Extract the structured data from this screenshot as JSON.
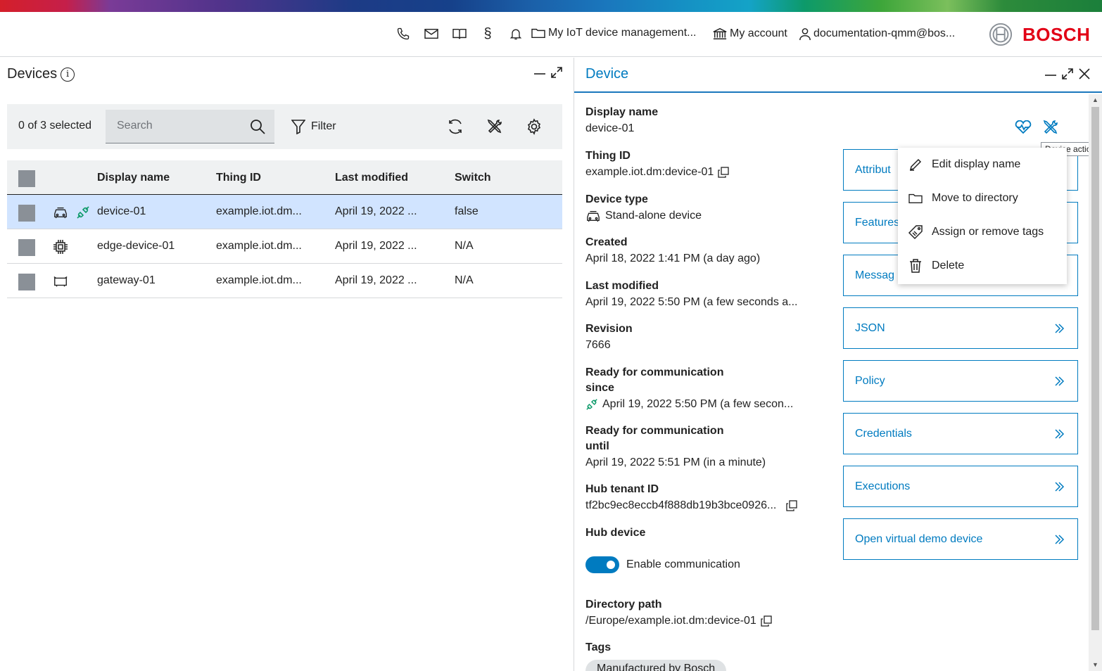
{
  "header": {
    "links": {
      "directory": "My IoT device management...",
      "account": "My account",
      "user": "documentation-qmm@bos..."
    },
    "brand": "BOSCH"
  },
  "devices_panel": {
    "title": "Devices",
    "selected_count": "0 of 3 selected",
    "search_placeholder": "Search",
    "filter_label": "Filter",
    "columns": [
      "Display name",
      "Thing ID",
      "Last modified",
      "Switch"
    ],
    "rows": [
      {
        "display_name": "device-01",
        "thing_id": "example.iot.dm...",
        "last_modified": "April 19, 2022 ...",
        "switch": "false",
        "type_icon": "car-icon",
        "connected": true
      },
      {
        "display_name": "edge-device-01",
        "thing_id": "example.iot.dm...",
        "last_modified": "April 19, 2022 ...",
        "switch": "N/A",
        "type_icon": "chip-icon",
        "connected": false
      },
      {
        "display_name": "gateway-01",
        "thing_id": "example.iot.dm...",
        "last_modified": "April 19, 2022 ...",
        "switch": "N/A",
        "type_icon": "gateway-icon",
        "connected": false
      }
    ]
  },
  "device_panel": {
    "title": "Device",
    "fields": {
      "display_name": {
        "label": "Display name",
        "value": "device-01"
      },
      "thing_id": {
        "label": "Thing ID",
        "value": "example.iot.dm:device-01"
      },
      "device_type": {
        "label": "Device type",
        "value": "Stand-alone device"
      },
      "created": {
        "label": "Created",
        "value": "April 18, 2022 1:41 PM (a day ago)"
      },
      "last_modified": {
        "label": "Last modified",
        "value": "April 19, 2022 5:50 PM (a few seconds a..."
      },
      "revision": {
        "label": "Revision",
        "value": "7666"
      },
      "ready_since": {
        "label_1": "Ready for communication",
        "label_2": "since",
        "value": "April 19, 2022 5:50 PM (a few secon..."
      },
      "ready_until": {
        "label_1": "Ready for communication",
        "label_2": "until",
        "value": "April 19, 2022 5:51 PM (in a minute)"
      },
      "hub_tenant": {
        "label": "Hub tenant ID",
        "value": "tf2bc9ec8eccb4f888db19b3bce0926..."
      },
      "hub_device": {
        "label": "Hub device",
        "toggle_label": "Enable communication",
        "enabled": true
      },
      "directory_path": {
        "label": "Directory path",
        "value": "/Europe/example.iot.dm:device-01"
      },
      "tags": {
        "label": "Tags",
        "items": [
          "Manufactured by Bosch"
        ]
      }
    },
    "nav_cards": [
      "Attribut",
      "Features",
      "Messag",
      "JSON",
      "Policy",
      "Credentials",
      "Executions",
      "Open virtual demo device"
    ],
    "tooltip": "Device actions",
    "actions_menu": [
      "Edit display name",
      "Move to directory",
      "Assign or remove tags",
      "Delete"
    ]
  },
  "colors": {
    "accent": "#007bc0",
    "brand_red": "#e20015",
    "connected_green": "#0d9a6a",
    "selected_row": "#d1e4ff"
  }
}
